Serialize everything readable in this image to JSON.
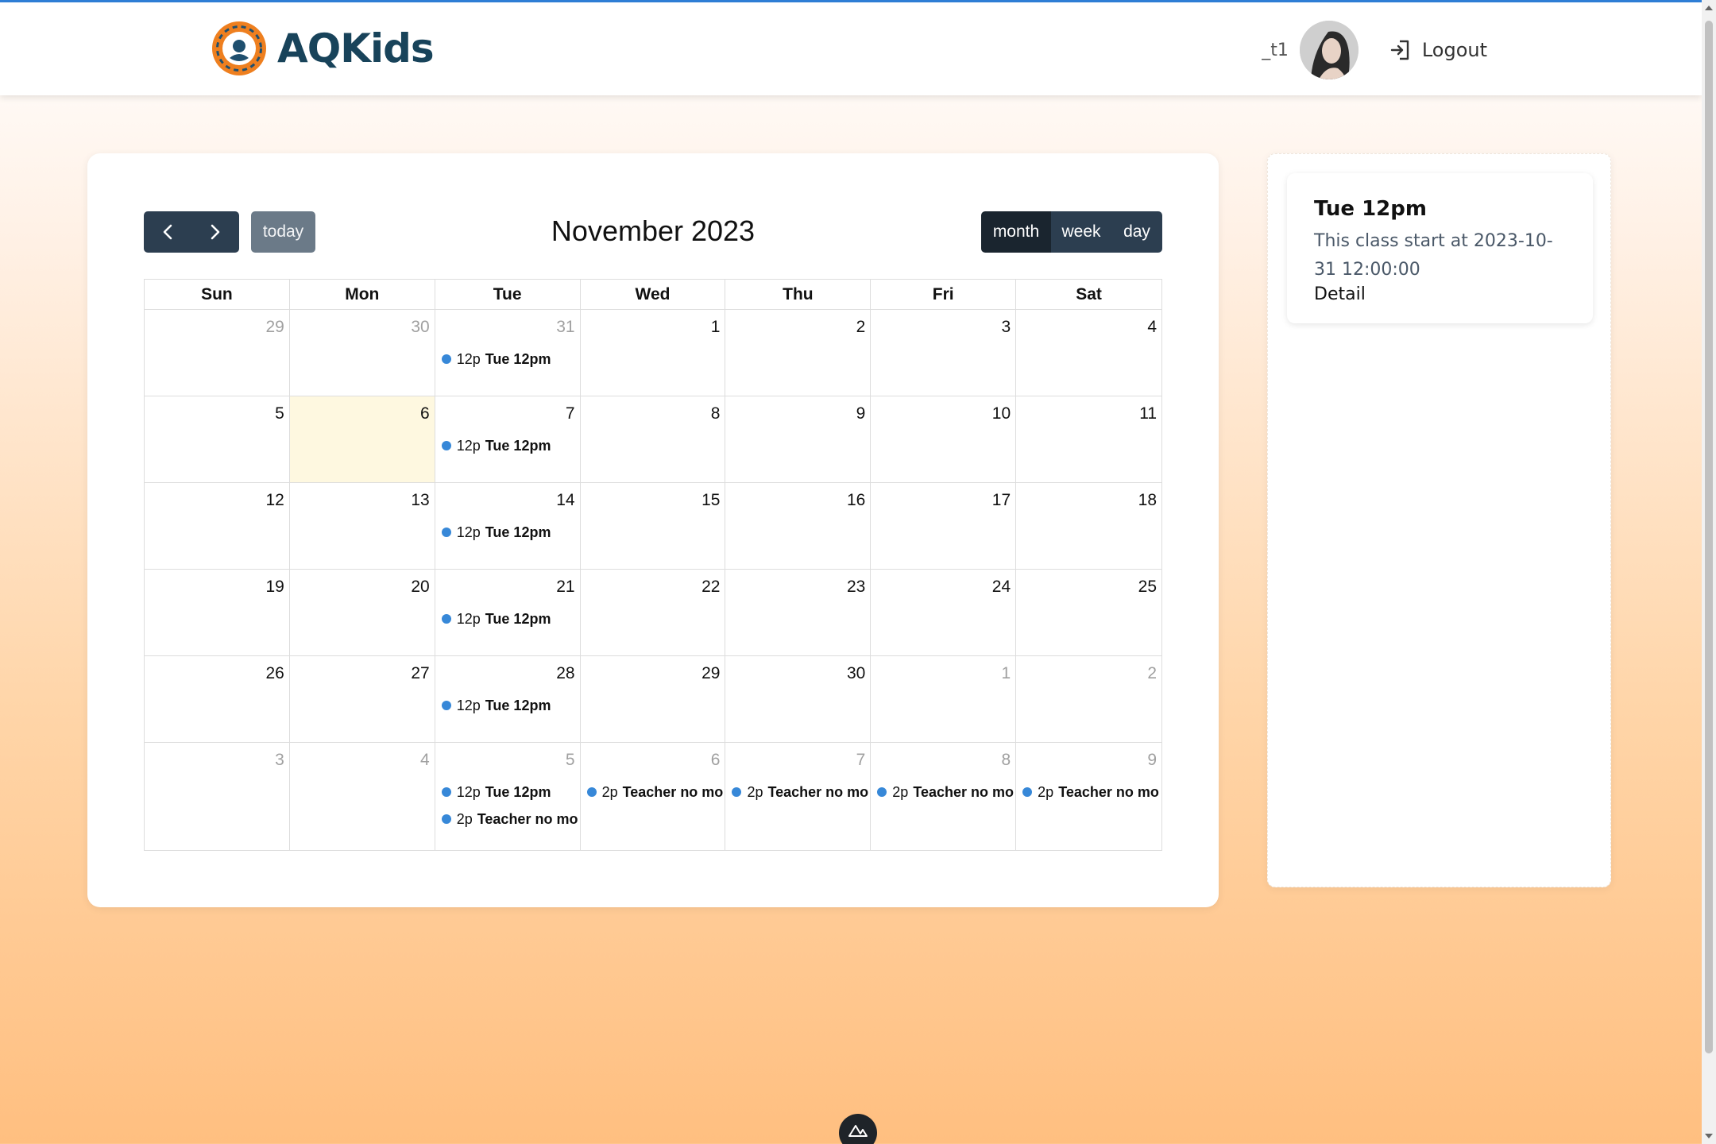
{
  "brand": {
    "name": "AQKids"
  },
  "header": {
    "username": "_t1",
    "logout_label": "Logout"
  },
  "calendar": {
    "title": "November 2023",
    "today_label": "today",
    "views": [
      "month",
      "week",
      "day"
    ],
    "active_view": "month",
    "weekday_headers": [
      "Sun",
      "Mon",
      "Tue",
      "Wed",
      "Thu",
      "Fri",
      "Sat"
    ],
    "weeks": [
      [
        {
          "day": "29",
          "other": true,
          "events": []
        },
        {
          "day": "30",
          "other": true,
          "events": []
        },
        {
          "day": "31",
          "other": true,
          "events": [
            {
              "time": "12p",
              "title": "Tue 12pm"
            }
          ]
        },
        {
          "day": "1",
          "events": []
        },
        {
          "day": "2",
          "events": []
        },
        {
          "day": "3",
          "events": []
        },
        {
          "day": "4",
          "events": []
        }
      ],
      [
        {
          "day": "5",
          "events": []
        },
        {
          "day": "6",
          "today": true,
          "events": []
        },
        {
          "day": "7",
          "events": [
            {
              "time": "12p",
              "title": "Tue 12pm"
            }
          ]
        },
        {
          "day": "8",
          "events": []
        },
        {
          "day": "9",
          "events": []
        },
        {
          "day": "10",
          "events": []
        },
        {
          "day": "11",
          "events": []
        }
      ],
      [
        {
          "day": "12",
          "events": []
        },
        {
          "day": "13",
          "events": []
        },
        {
          "day": "14",
          "events": [
            {
              "time": "12p",
              "title": "Tue 12pm"
            }
          ]
        },
        {
          "day": "15",
          "events": []
        },
        {
          "day": "16",
          "events": []
        },
        {
          "day": "17",
          "events": []
        },
        {
          "day": "18",
          "events": []
        }
      ],
      [
        {
          "day": "19",
          "events": []
        },
        {
          "day": "20",
          "events": []
        },
        {
          "day": "21",
          "events": [
            {
              "time": "12p",
              "title": "Tue 12pm"
            }
          ]
        },
        {
          "day": "22",
          "events": []
        },
        {
          "day": "23",
          "events": []
        },
        {
          "day": "24",
          "events": []
        },
        {
          "day": "25",
          "events": []
        }
      ],
      [
        {
          "day": "26",
          "events": []
        },
        {
          "day": "27",
          "events": []
        },
        {
          "day": "28",
          "events": [
            {
              "time": "12p",
              "title": "Tue 12pm"
            }
          ]
        },
        {
          "day": "29",
          "events": []
        },
        {
          "day": "30",
          "events": []
        },
        {
          "day": "1",
          "other": true,
          "events": []
        },
        {
          "day": "2",
          "other": true,
          "events": []
        }
      ],
      [
        {
          "day": "3",
          "other": true,
          "events": []
        },
        {
          "day": "4",
          "other": true,
          "events": []
        },
        {
          "day": "5",
          "other": true,
          "events": [
            {
              "time": "12p",
              "title": "Tue 12pm"
            },
            {
              "time": "2p",
              "title": "Teacher no mo"
            }
          ]
        },
        {
          "day": "6",
          "other": true,
          "events": [
            {
              "time": "2p",
              "title": "Teacher no mo"
            }
          ]
        },
        {
          "day": "7",
          "other": true,
          "events": [
            {
              "time": "2p",
              "title": "Teacher no mo"
            }
          ]
        },
        {
          "day": "8",
          "other": true,
          "events": [
            {
              "time": "2p",
              "title": "Teacher no mo"
            }
          ]
        },
        {
          "day": "9",
          "other": true,
          "events": [
            {
              "time": "2p",
              "title": "Teacher no mo"
            }
          ]
        }
      ]
    ]
  },
  "event_detail": {
    "title": "Tue 12pm",
    "description": "This class start at 2023-10-31 12:00:00",
    "link_label": "Detail"
  },
  "colors": {
    "event_dot": "#3788d8",
    "button_dark": "#2c3e50",
    "button_active": "#1a252f",
    "today_highlight": "#fef8e0",
    "brand_text": "#18435a"
  }
}
